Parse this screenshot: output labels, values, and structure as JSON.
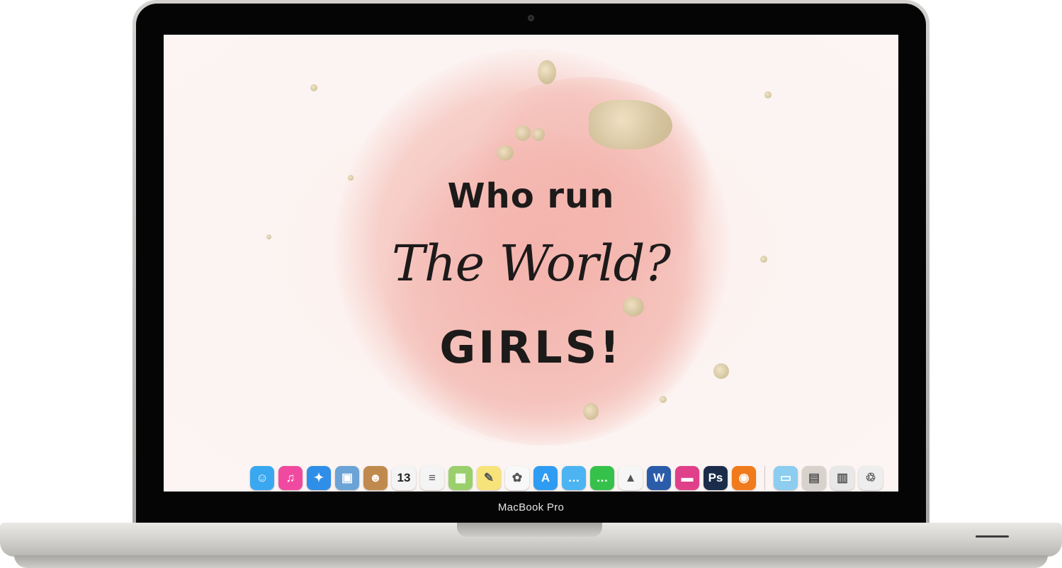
{
  "device": {
    "label": "MacBook Pro"
  },
  "wallpaper": {
    "line1": "Who run",
    "line2": "The World?",
    "line3": "GIRLS!"
  },
  "dock": {
    "items": [
      {
        "name": "finder-icon",
        "glyph": "☺",
        "bg": "#3aa8f0"
      },
      {
        "name": "itunes-icon",
        "glyph": "♫",
        "bg": "#f04aa0"
      },
      {
        "name": "safari-icon",
        "glyph": "✦",
        "bg": "#2f8ee8"
      },
      {
        "name": "preview-icon",
        "glyph": "▣",
        "bg": "#6aa3d6"
      },
      {
        "name": "contacts-icon",
        "glyph": "☻",
        "bg": "#c08a4e"
      },
      {
        "name": "calendar-icon",
        "glyph": "13",
        "bg": "#f4f4f4"
      },
      {
        "name": "reminders-icon",
        "glyph": "≡",
        "bg": "#f4f4f4"
      },
      {
        "name": "photo-booth-icon",
        "glyph": "▦",
        "bg": "#9ad06c"
      },
      {
        "name": "notes-icon",
        "glyph": "✎",
        "bg": "#f7e37a"
      },
      {
        "name": "photos-icon",
        "glyph": "✿",
        "bg": "#f8f8f8"
      },
      {
        "name": "app-store-icon",
        "glyph": "A",
        "bg": "#2e9cf2"
      },
      {
        "name": "messages-icon",
        "glyph": "…",
        "bg": "#4cb4f2"
      },
      {
        "name": "facetime-icon",
        "glyph": "…",
        "bg": "#36c24a"
      },
      {
        "name": "google-drive-icon",
        "glyph": "▲",
        "bg": "#f6f6f6"
      },
      {
        "name": "word-icon",
        "glyph": "W",
        "bg": "#2b5caa"
      },
      {
        "name": "cleanmymac-icon",
        "glyph": "▬",
        "bg": "#e0408a"
      },
      {
        "name": "photoshop-icon",
        "glyph": "Ps",
        "bg": "#1a2c4a"
      },
      {
        "name": "firefox-icon",
        "glyph": "◉",
        "bg": "#f07a1c"
      },
      {
        "name": "folder-icon",
        "glyph": "▭",
        "bg": "#8ccdf0"
      },
      {
        "name": "downloads-stack-icon",
        "glyph": "▤",
        "bg": "#d8d2cc"
      },
      {
        "name": "documents-stack-icon",
        "glyph": "▥",
        "bg": "#e8e8e8"
      },
      {
        "name": "trash-icon",
        "glyph": "♲",
        "bg": "#eeeeee"
      }
    ]
  }
}
